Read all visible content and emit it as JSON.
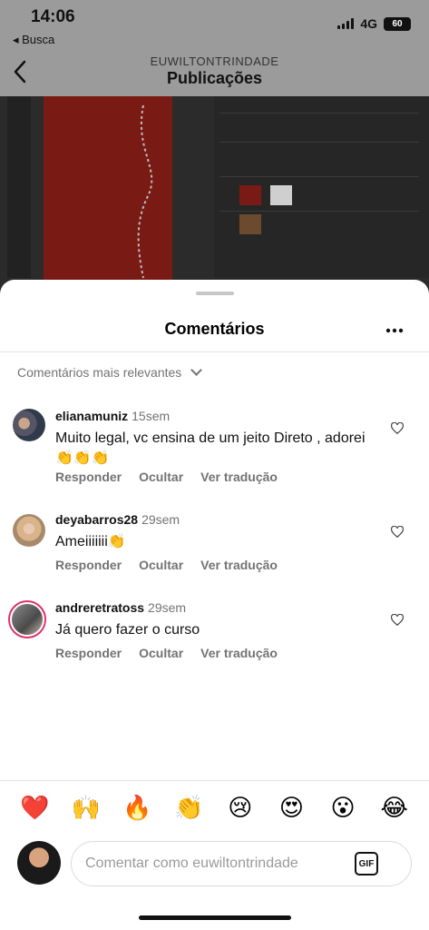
{
  "status_bar": {
    "time": "14:06",
    "back_app": "◂ Busca",
    "network": "4G",
    "battery": "60"
  },
  "header": {
    "account": "EUWILTONTRINDADE",
    "title": "Publicações"
  },
  "sheet": {
    "title": "Comentários",
    "sort_label": "Comentários mais relevantes"
  },
  "comments": [
    {
      "username": "elianamuniz",
      "time": "15sem",
      "text": "Muito legal, vc ensina de um jeito Direto , adorei 👏👏👏",
      "reply": "Responder",
      "hide": "Ocultar",
      "translate": "Ver tradução"
    },
    {
      "username": "deyabarros28",
      "time": "29sem",
      "text": "Ameiiiiiii👏",
      "reply": "Responder",
      "hide": "Ocultar",
      "translate": "Ver tradução"
    },
    {
      "username": "andreretratoss",
      "time": "29sem",
      "text": "Já quero fazer o curso",
      "reply": "Responder",
      "hide": "Ocultar",
      "translate": "Ver tradução"
    }
  ],
  "reactions": [
    "❤️",
    "🙌",
    "🔥",
    "👏",
    "😢",
    "😍",
    "😮",
    "😂"
  ],
  "composer": {
    "placeholder": "Comentar como euwiltontrindade",
    "gif_label": "GIF"
  },
  "icons": {
    "back": "chevron-left-icon",
    "more": "ellipsis-icon",
    "sort": "chevron-down-icon",
    "like": "heart-icon",
    "gif": "gif-icon"
  },
  "colors": {
    "story_ring": "#e1306c",
    "muted_text": "#737373",
    "divider": "#e3e3e3"
  }
}
